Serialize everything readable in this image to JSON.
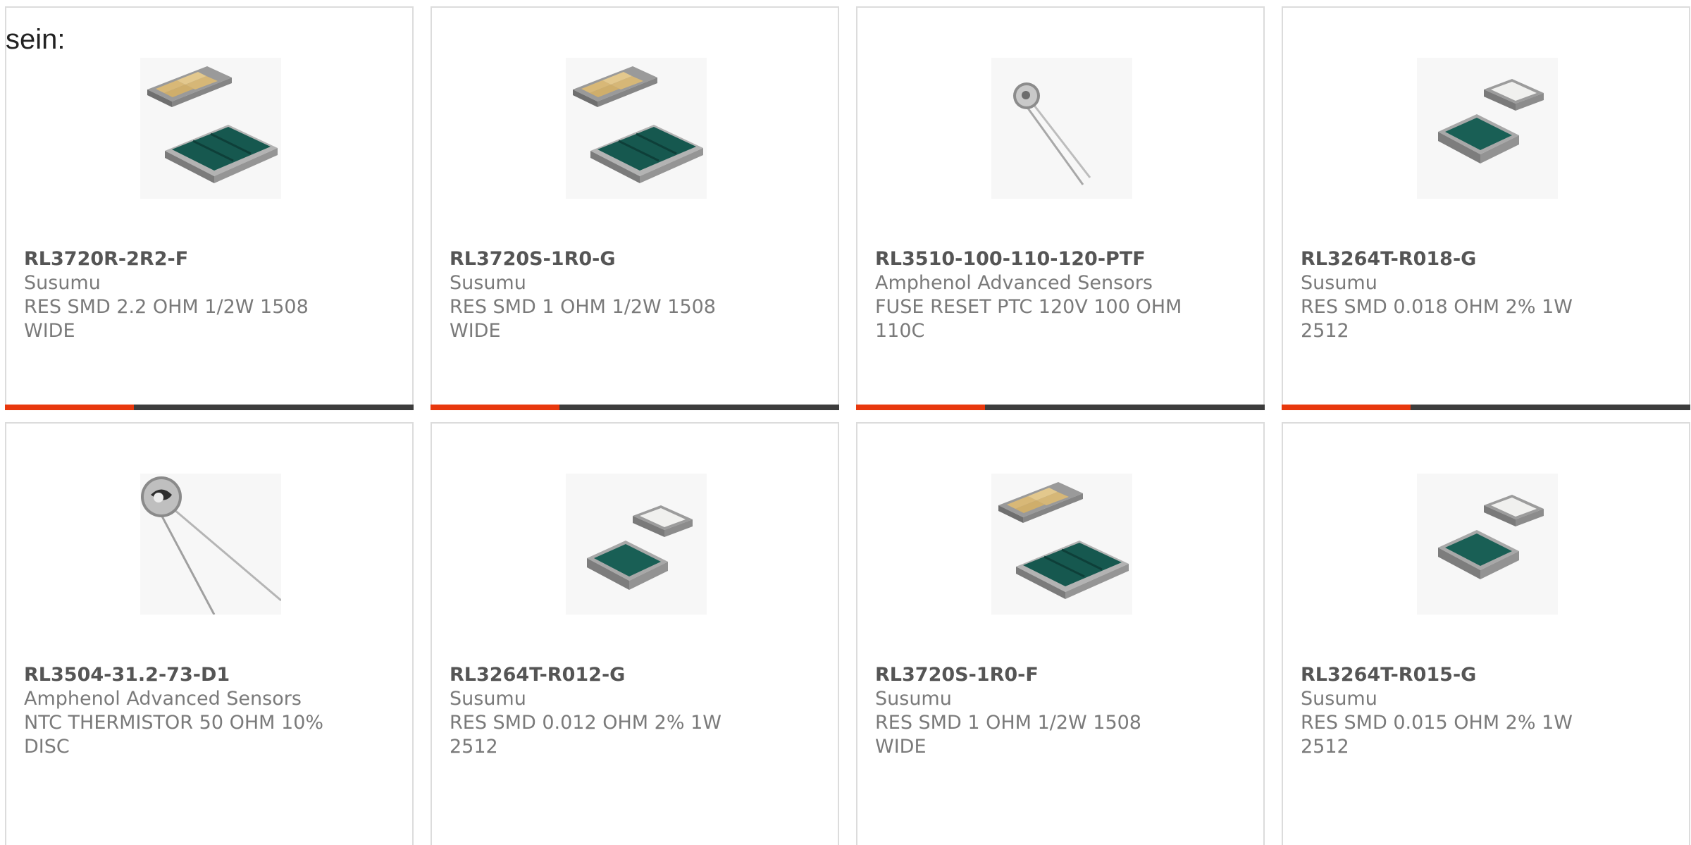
{
  "intro_text": "sein:",
  "accent_color": "#e8380d",
  "bar_color": "#3d3d3d",
  "products": [
    {
      "part_number": "RL3720R-2R2-F",
      "manufacturer": "Susumu",
      "description": "RES SMD 2.2 OHM 1/2W 1508 WIDE",
      "image": "wide-smd-resistor-image"
    },
    {
      "part_number": "RL3720S-1R0-G",
      "manufacturer": "Susumu",
      "description": "RES SMD 1 OHM 1/2W 1508 WIDE",
      "image": "wide-smd-resistor-image"
    },
    {
      "part_number": "RL3510-100-110-120-PTF",
      "manufacturer": "Amphenol Advanced Sensors",
      "description": "FUSE RESET PTC 120V 100 OHM 110C",
      "image": "radial-disc-component-image"
    },
    {
      "part_number": "RL3264T-R018-G",
      "manufacturer": "Susumu",
      "description": "RES SMD 0.018 OHM 2% 1W 2512",
      "image": "chip-resistor-image"
    },
    {
      "part_number": "RL3504-31.2-73-D1",
      "manufacturer": "Amphenol Advanced Sensors",
      "description": "NTC THERMISTOR 50 OHM 10% DISC",
      "image": "disc-thermistor-image"
    },
    {
      "part_number": "RL3264T-R012-G",
      "manufacturer": "Susumu",
      "description": "RES SMD 0.012 OHM 2% 1W 2512",
      "image": "chip-resistor-image"
    },
    {
      "part_number": "RL3720S-1R0-F",
      "manufacturer": "Susumu",
      "description": "RES SMD 1 OHM 1/2W 1508 WIDE",
      "image": "wide-smd-resistor-image"
    },
    {
      "part_number": "RL3264T-R015-G",
      "manufacturer": "Susumu",
      "description": "RES SMD 0.015 OHM 2% 1W 2512",
      "image": "chip-resistor-image"
    }
  ]
}
